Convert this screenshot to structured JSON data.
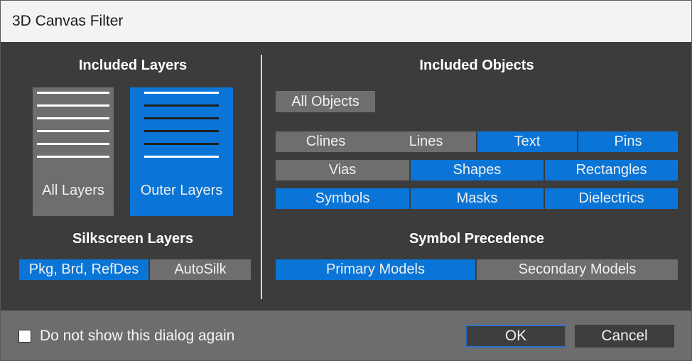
{
  "window": {
    "title": "3D Canvas Filter"
  },
  "included_layers": {
    "heading": "Included Layers",
    "all_layers": {
      "label": "All Layers",
      "selected": false
    },
    "outer_layers": {
      "label": "Outer Layers",
      "selected": true
    }
  },
  "silkscreen": {
    "heading": "Silkscreen Layers",
    "options": [
      {
        "label": "Pkg, Brd, RefDes",
        "selected": true
      },
      {
        "label": "AutoSilk",
        "selected": false
      }
    ]
  },
  "included_objects": {
    "heading": "Included Objects",
    "all_objects_label": "All Objects",
    "row1": [
      {
        "label": "Clines",
        "selected": false
      },
      {
        "label": "Lines",
        "selected": false
      },
      {
        "label": "Text",
        "selected": true
      },
      {
        "label": "Pins",
        "selected": true
      }
    ],
    "row2": [
      {
        "label": "Vias",
        "selected": false
      },
      {
        "label": "Shapes",
        "selected": true
      },
      {
        "label": "Rectangles",
        "selected": true
      }
    ],
    "row3": [
      {
        "label": "Symbols",
        "selected": true
      },
      {
        "label": "Masks",
        "selected": true
      },
      {
        "label": "Dielectrics",
        "selected": true
      }
    ]
  },
  "symbol_precedence": {
    "heading": "Symbol Precedence",
    "options": [
      {
        "label": "Primary Models",
        "selected": true
      },
      {
        "label": "Secondary Models",
        "selected": false
      }
    ]
  },
  "footer": {
    "checkbox_label": "Do not show this dialog again",
    "checkbox_checked": false,
    "ok_label": "OK",
    "cancel_label": "Cancel"
  },
  "colors": {
    "accent": "#0a75d6",
    "unselected": "#6e6e6e",
    "panel": "#3c3c3c",
    "footer": "#6d6d6d"
  }
}
